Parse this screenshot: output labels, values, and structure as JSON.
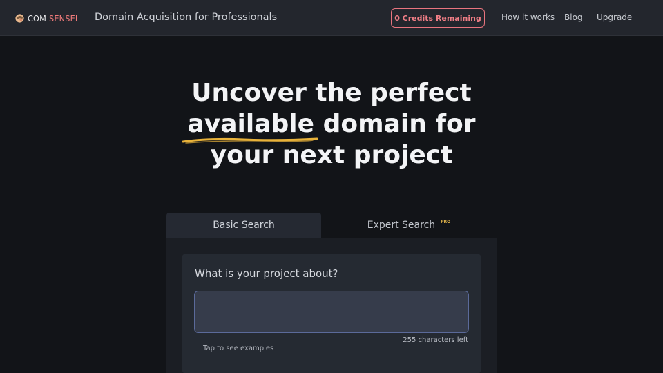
{
  "brand": {
    "name_part1": "COM",
    "name_part2": "SENSEI",
    "tagline": "Domain Acquisition for Professionals"
  },
  "nav": {
    "credits_label": "0 Credits Remaining",
    "links": [
      "How it works",
      "Blog",
      "Upgrade"
    ]
  },
  "hero": {
    "line1": "Uncover the perfect",
    "line2_highlight": "available",
    "line2_rest": " domain for",
    "line3": "your next project"
  },
  "tabs": {
    "basic": "Basic Search",
    "expert": "Expert Search",
    "expert_badge": "PRO"
  },
  "search": {
    "question": "What is your project about?",
    "value": "",
    "chars_left": "255 characters left",
    "examples_link": "Tap to see examples"
  },
  "colors": {
    "accent_red": "#f07e86",
    "highlight_yellow": "#e8b23a",
    "pro_badge": "#e0b34a"
  }
}
